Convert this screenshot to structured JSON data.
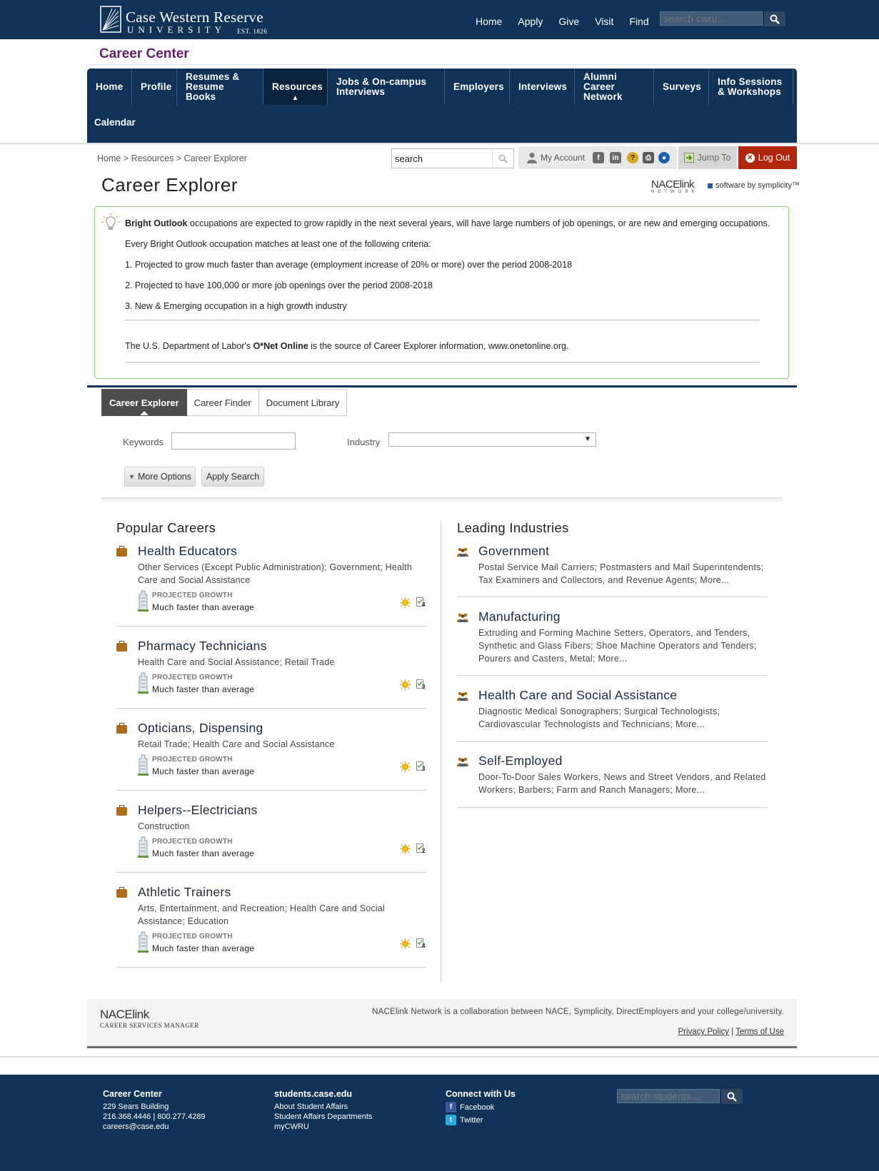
{
  "university": {
    "name": "Case Western Reserve",
    "sub": "UNIVERSITY",
    "est": "EST. 1826",
    "nav": [
      "Home",
      "Apply",
      "Give",
      "Visit",
      "Find"
    ],
    "search_placeholder": "search cwru..."
  },
  "site_title": "Career Center",
  "main_nav": {
    "items": [
      "Home",
      "Profile",
      "Resumes & Resume Books",
      "Resources",
      "Jobs & On-campus Interviews",
      "Employers",
      "Interviews",
      "Alumni Career Network",
      "Surveys",
      "Info Sessions & Workshops"
    ],
    "active": "Resources",
    "row2": "Calendar"
  },
  "breadcrumb": "Home > Resources > Career Explorer",
  "site_search": {
    "value": "search"
  },
  "utility": {
    "my_account": "My Account",
    "jump_to": "Jump To",
    "log_out": "Log Out"
  },
  "page_title": "Career Explorer",
  "branding": {
    "nacelink": "NACElink",
    "network": "NETWORK",
    "symplicity": "software by symplicity™"
  },
  "info": {
    "bright_label": "Bright Outlook",
    "intro_rest": " occupations are expected to grow rapidly in the next several years, will have large numbers of job openings, or are new and emerging occupations.",
    "criteria_heading": "Every Bright Outlook occupation matches at least one of the following criteria:",
    "criteria": [
      "1. Projected to grow much faster than average (employment increase of 20% or more) over the period 2008-2018",
      "2. Projected to have 100,000 or more job openings over the period 2008-2018",
      "3. New & Emerging occupation in a high growth industry"
    ],
    "source_prefix": "The U.S. Department of Labor's ",
    "source_bold": "O*Net Online",
    "source_suffix": " is the source of Career Explorer information, www.onetonline.org."
  },
  "tabs": [
    "Career Explorer",
    "Career Finder",
    "Document Library"
  ],
  "form": {
    "keywords_label": "Keywords",
    "keywords_value": "",
    "industry_label": "Industry",
    "industry_value": "",
    "more_options": "More Options",
    "apply_search": "Apply Search"
  },
  "popular": {
    "title": "Popular Careers",
    "growth_label": "PROJECTED GROWTH",
    "careers": [
      {
        "name": "Health Educators",
        "industries": "Other Services (Except Public Administration); Government; Health Care and Social Assistance",
        "growth": "Much faster than average",
        "docs": "4"
      },
      {
        "name": "Pharmacy Technicians",
        "industries": "Health Care and Social Assistance; Retail Trade",
        "growth": "Much faster than average",
        "docs": "3"
      },
      {
        "name": "Opticians, Dispensing",
        "industries": "Retail Trade; Health Care and Social Assistance",
        "growth": "Much faster than average",
        "docs": "3"
      },
      {
        "name": "Helpers--Electricians",
        "industries": "Construction",
        "growth": "Much faster than average",
        "docs": "2"
      },
      {
        "name": "Athletic Trainers",
        "industries": "Arts, Entertainment, and Recreation; Health Care and Social Assistance; Education",
        "growth": "Much faster than average",
        "docs": "4"
      }
    ]
  },
  "leading": {
    "title": "Leading Industries",
    "industries": [
      {
        "name": "Government",
        "jobs": "Postal Service Mail Carriers; Postmasters and Mail Superintendents; Tax Examiners and Collectors, and Revenue Agents; More..."
      },
      {
        "name": "Manufacturing",
        "jobs": "Extruding and Forming Machine Setters, Operators, and Tenders, Synthetic and Glass Fibers; Shoe Machine Operators and Tenders; Pourers and Casters, Metal; More..."
      },
      {
        "name": "Health Care and Social Assistance",
        "jobs": "Diagnostic Medical Sonographers; Surgical Technologists; Cardiovascular Technologists and Technicians; More..."
      },
      {
        "name": "Self-Employed",
        "jobs": "Door-To-Door Sales Workers, News and Street Vendors, and Related Workers; Barbers; Farm and Ranch Managers; More..."
      }
    ]
  },
  "nace_footer": {
    "logo": "NACElink",
    "logo_sub": "CAREER SERVICES MANAGER",
    "collab": "NACElink Network is a collaboration between NACE, Symplicity, DirectEmployers and your college/university.",
    "privacy": "Privacy Policy",
    "terms": "Terms of Use",
    "divider": "|"
  },
  "footer": {
    "col1": {
      "title": "Career Center",
      "lines": [
        "229 Sears Building",
        "216.368.4446 | 800.277.4289",
        "careers@case.edu"
      ]
    },
    "col2": {
      "title": "students.case.edu",
      "lines": [
        "About Student Affairs",
        "Student Affairs Departments",
        "myCWRU"
      ]
    },
    "col3": {
      "title": "Connect with Us",
      "facebook": "Facebook",
      "twitter": "Twitter"
    },
    "search_placeholder": "search students..."
  },
  "colors": {
    "navy": "#0f3256",
    "purple": "#66206a",
    "logout_red": "#b0260f",
    "box_green": "#8ed17a"
  }
}
